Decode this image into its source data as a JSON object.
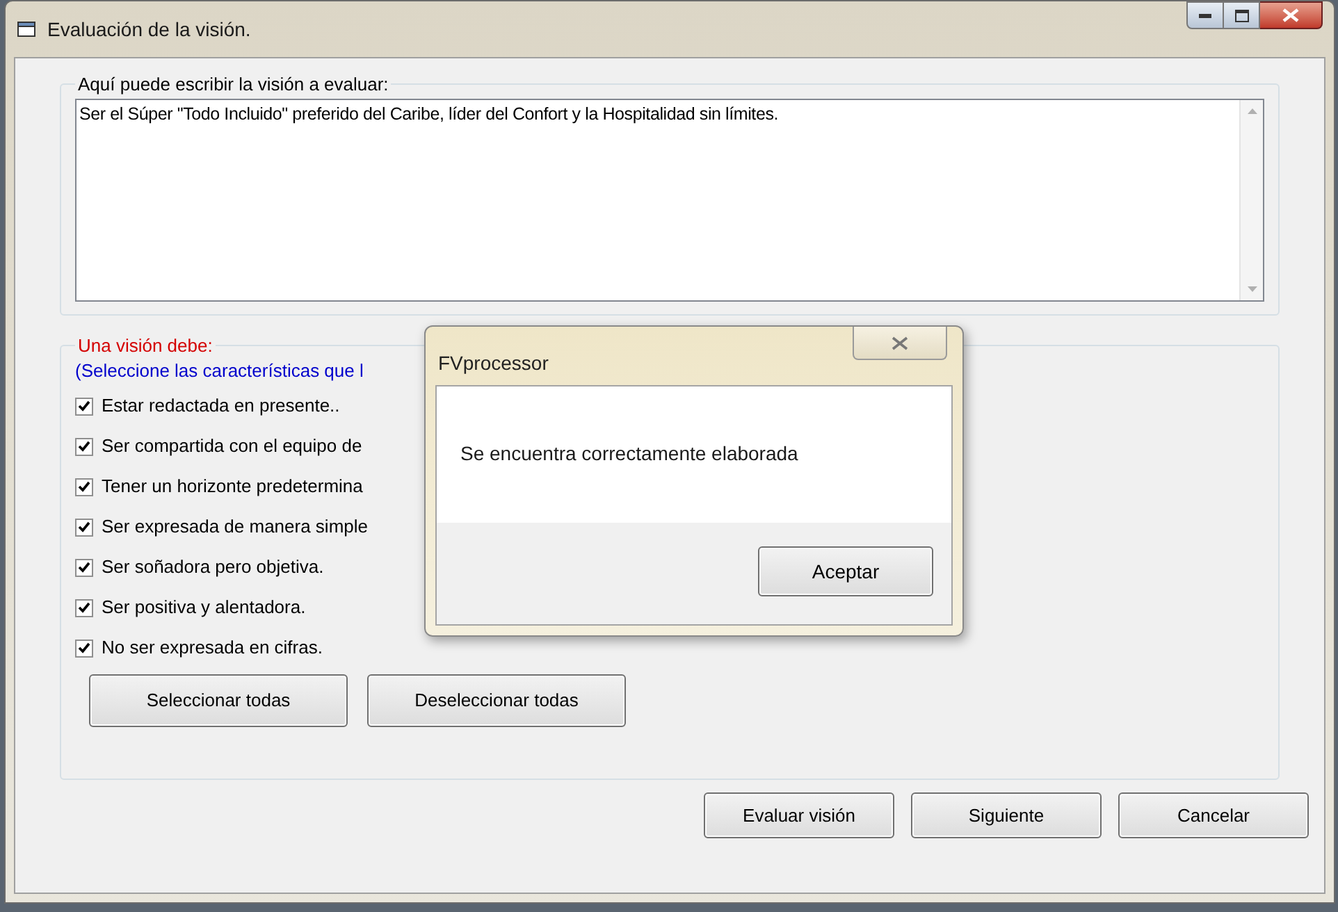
{
  "window": {
    "title": "Evaluación de la visión."
  },
  "vision_group": {
    "label": "Aquí puede escribir  la visión a evaluar:",
    "value": "Ser el Súper  \"Todo Incluido\" preferido del Caribe, líder del Confort y la Hospitalidad sin límites."
  },
  "criteria_group": {
    "label": "Una visión debe:",
    "hint": "(Seleccione las características que l",
    "items": [
      {
        "label": "Estar redactada en presente..",
        "checked": true
      },
      {
        "label": "Ser compartida con el equipo de",
        "checked": true
      },
      {
        "label": "Tener un horizonte predetermina",
        "checked": true
      },
      {
        "label": "Ser expresada de manera simple",
        "checked": true
      },
      {
        "label": "Ser soñadora pero objetiva.",
        "checked": true
      },
      {
        "label": "Ser positiva y alentadora.",
        "checked": true
      },
      {
        "label": "No ser expresada en cifras.",
        "checked": true
      }
    ],
    "buttons": [
      "Seleccionar todas",
      "Deseleccionar todas"
    ]
  },
  "footer_buttons": [
    "Evaluar visión",
    "Siguiente",
    "Cancelar"
  ],
  "message_box": {
    "title": "FVprocessor",
    "message": "Se encuentra correctamente elaborada",
    "button": "Aceptar"
  }
}
